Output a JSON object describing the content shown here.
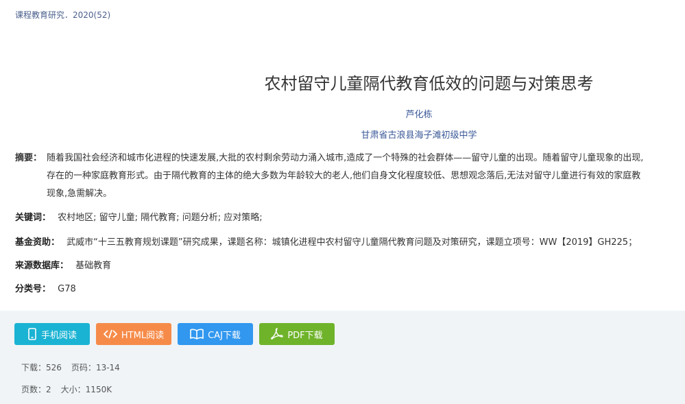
{
  "header": {
    "source_line": "课程教育研究．2020(52)"
  },
  "article": {
    "title": "农村留守儿童隔代教育低效的问题与对策思考",
    "author": "芦化栋",
    "organization": "甘肃省古浪县海子滩初级中学",
    "abstract_label": "摘要：",
    "abstract_lines": [
      "随着我国社会经济和城市化进程的快速发展,大批的农村剩余劳动力涌入城市,造成了一个特殊的社会群体——留守儿童的出现。随着留守儿童现象的出现,",
      "存在的一种家庭教育形式。由于隔代教育的主体的绝大多数为年龄较大的老人,他们自身文化程度较低、思想观念落后,无法对留守儿童进行有效的家庭教",
      "现象,急需解决。"
    ],
    "keywords_label": "关键词：",
    "keywords": "农村地区;  留守儿童;  隔代教育;  问题分析;  应对策略;",
    "fund_label": "基金资助：",
    "fund": "武威市“十三五教育规划课题”研究成果，课题名称：城镇化进程中农村留守儿童隔代教育问题及对策研究，课题立项号：WW【2019】GH225；",
    "database_label": "来源数据库：",
    "database": "基础教育",
    "class_label": "分类号：",
    "class_code": "G78"
  },
  "actions": {
    "mobile": "手机阅读",
    "html": "HTML阅读",
    "caj": "CAJ下载",
    "pdf": "PDF下载"
  },
  "stats": {
    "downloads_label": "下载：",
    "downloads": "526",
    "pages_label": "页码：",
    "pages": "13-14",
    "page_count_label": "页数：",
    "page_count": "2",
    "size_label": "大小：",
    "size": "1150K"
  },
  "colors": {
    "mobile": "#1bb3d3",
    "html": "#f68b49",
    "caj": "#3197ef",
    "pdf": "#6fb32b"
  }
}
